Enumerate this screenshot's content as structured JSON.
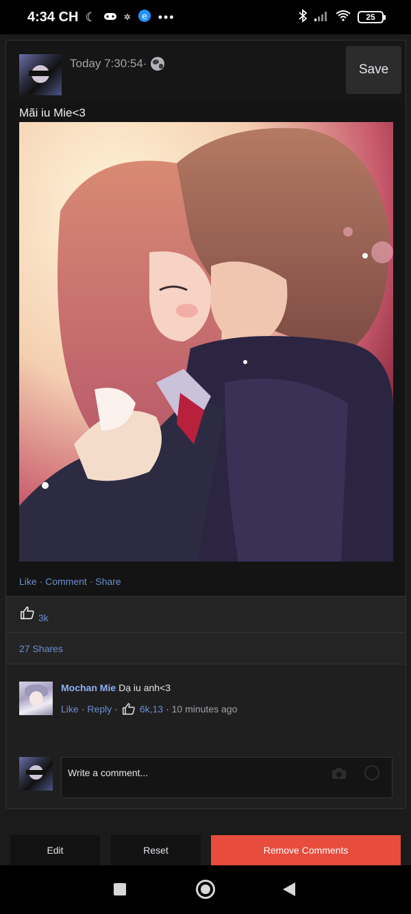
{
  "status_bar": {
    "time": "4:34 CH",
    "battery": "25",
    "icons": [
      "moon-icon",
      "gamepad-icon",
      "app-icon",
      "edge-icon",
      "more-icon",
      "bluetooth-icon",
      "signal-icon",
      "wifi-icon",
      "battery-icon"
    ]
  },
  "post": {
    "timestamp": "Today 7:30:54·",
    "save_label": "Save",
    "text": "Mãi iu Mie<3",
    "actions": {
      "like": "Like",
      "comment": "Comment",
      "share": "Share"
    },
    "likes": "3k",
    "shares": "27 Shares"
  },
  "comment": {
    "author": "Mochan Mie",
    "text": "Dạ iu anh<3",
    "like": "Like",
    "reply": "Reply",
    "reactions": "6k,13",
    "time": "· 10 minutes ago"
  },
  "composer": {
    "placeholder": "Write a comment..."
  },
  "buttons": {
    "edit": "Edit",
    "reset": "Reset",
    "remove": "Remove Comments"
  },
  "colors": {
    "accent_link": "#6a8fd1",
    "author_name": "#8fb0f5",
    "remove_button": "#e74c3c"
  }
}
